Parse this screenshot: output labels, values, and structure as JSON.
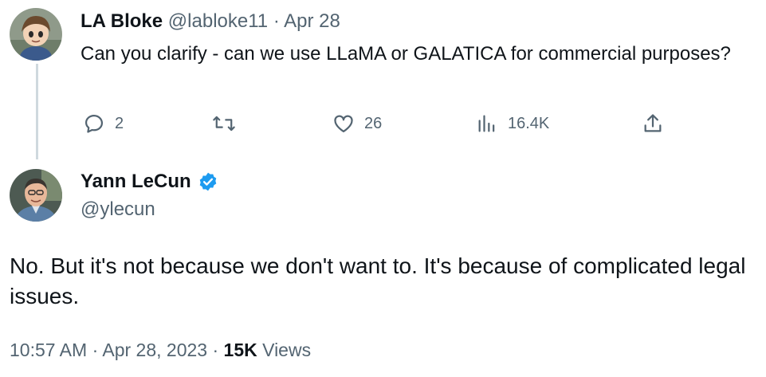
{
  "reply_tweet": {
    "author_name": "LA Bloke",
    "author_handle": "@labloke11",
    "separator": "·",
    "date": "Apr 28",
    "text": "Can you clarify - can we use LLaMA or GALATICA for commercial purposes?",
    "actions": {
      "replies": "2",
      "reposts": "",
      "likes": "26",
      "views": "16.4K"
    },
    "icons": [
      "reply-icon",
      "retweet-icon",
      "heart-icon",
      "views-icon",
      "share-icon"
    ]
  },
  "main_tweet": {
    "author_name": "Yann LeCun",
    "author_handle": "@ylecun",
    "verified": true,
    "text": "No. But it's not because we don't want to. It's because of complicated legal issues.",
    "time": "10:57 AM",
    "separator1": "·",
    "date": "Apr 28, 2023",
    "separator2": "·",
    "views_count": "15K",
    "views_label": "Views"
  },
  "colors": {
    "text_primary": "#0f1419",
    "text_secondary": "#536471",
    "verified_blue": "#1d9bf0",
    "thread_line": "#cfd9de"
  }
}
